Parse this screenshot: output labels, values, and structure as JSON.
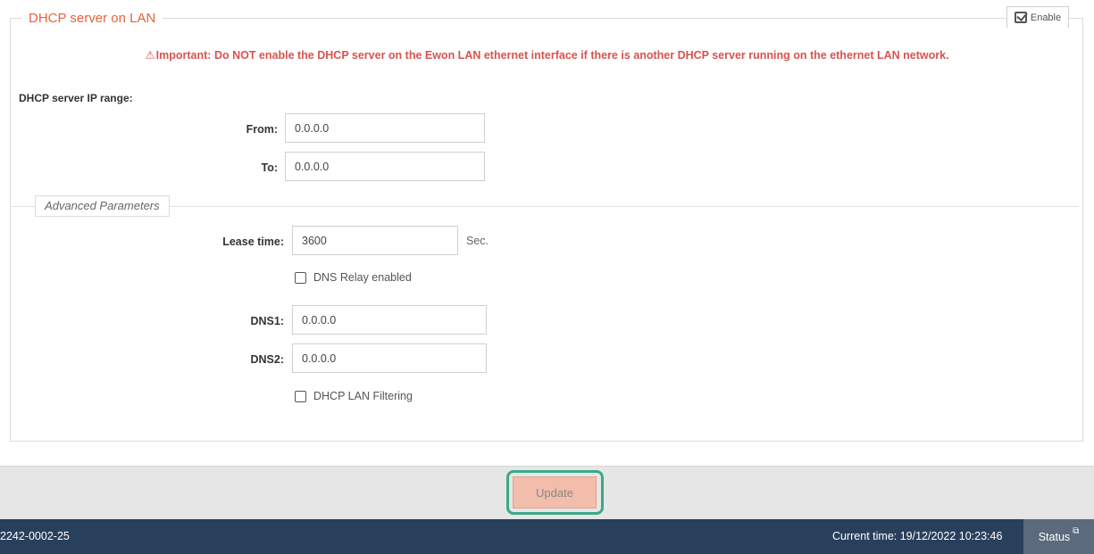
{
  "section": {
    "title": "DHCP server on LAN",
    "enable_label": "Enable",
    "enabled": true
  },
  "warning": {
    "icon": "warning-triangle-icon",
    "text": "Important: Do NOT enable the DHCP server on the Ewon LAN ethernet interface if there is another DHCP server running on the ethernet LAN network.",
    "color": "#d9534f"
  },
  "ip_range": {
    "label": "DHCP server IP range:",
    "from_label": "From:",
    "from_value": "0.0.0.0",
    "to_label": "To:",
    "to_value": "0.0.0.0"
  },
  "advanced": {
    "title": "Advanced Parameters",
    "lease_time_label": "Lease time:",
    "lease_time_value": "3600",
    "lease_time_unit": "Sec.",
    "dns_relay_label": "DNS Relay enabled",
    "dns_relay_checked": false,
    "dns1_label": "DNS1:",
    "dns1_value": "0.0.0.0",
    "dns2_label": "DNS2:",
    "dns2_value": "0.0.0.0",
    "lan_filtering_label": "DHCP LAN Filtering",
    "lan_filtering_checked": false
  },
  "actions": {
    "update_label": "Update",
    "update_color": "#f2bdaa",
    "highlight_color": "#3aa989"
  },
  "footer": {
    "device_id": "2242-0002-25",
    "current_time": "Current time: 19/12/2022 10:23:46",
    "status_label": "Status",
    "status_icon": "external-link-icon",
    "background": "#29405c"
  },
  "colors": {
    "accent": "#e8623a"
  }
}
